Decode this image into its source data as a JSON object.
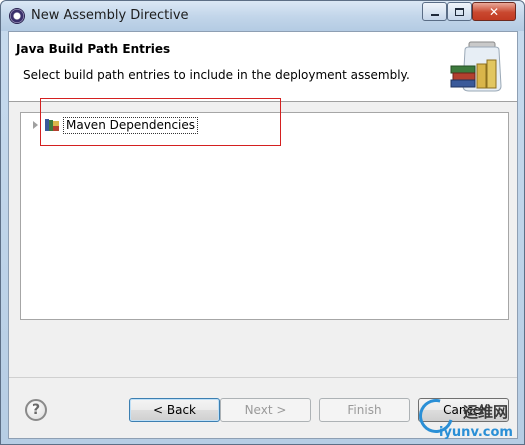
{
  "window": {
    "title": "New Assembly Directive",
    "controls": {
      "minimize": "minimize",
      "maximize": "maximize",
      "close": "✕"
    }
  },
  "header": {
    "title": "Java Build Path Entries",
    "description": "Select build path entries to include in the deployment assembly.",
    "icon": "jar-library-icon"
  },
  "tree": {
    "items": [
      {
        "label": "Maven Dependencies",
        "icon": "library-icon",
        "expanded": false
      }
    ]
  },
  "footer": {
    "help": "?",
    "buttons": {
      "back": "< Back",
      "next": "Next >",
      "finish": "Finish",
      "cancel": "Cancel"
    }
  },
  "annotation": {
    "color": "#d42020"
  },
  "watermark": {
    "cn": "运维网",
    "url": "iyunv.com"
  },
  "colors": {
    "accent": "#3c7fb1",
    "close": "#c9482f"
  }
}
